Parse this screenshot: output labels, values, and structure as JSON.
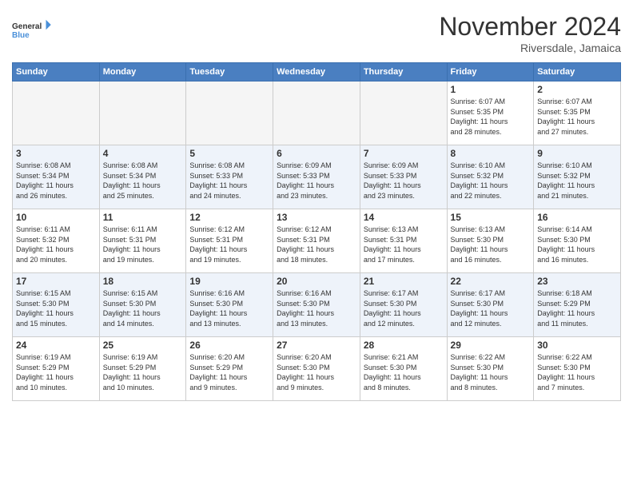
{
  "logo": {
    "line1": "General",
    "line2": "Blue"
  },
  "title": "November 2024",
  "location": "Riversdale, Jamaica",
  "days_of_week": [
    "Sunday",
    "Monday",
    "Tuesday",
    "Wednesday",
    "Thursday",
    "Friday",
    "Saturday"
  ],
  "weeks": [
    [
      {
        "day": "",
        "info": "",
        "empty": true
      },
      {
        "day": "",
        "info": "",
        "empty": true
      },
      {
        "day": "",
        "info": "",
        "empty": true
      },
      {
        "day": "",
        "info": "",
        "empty": true
      },
      {
        "day": "",
        "info": "",
        "empty": true
      },
      {
        "day": "1",
        "info": "Sunrise: 6:07 AM\nSunset: 5:35 PM\nDaylight: 11 hours\nand 28 minutes."
      },
      {
        "day": "2",
        "info": "Sunrise: 6:07 AM\nSunset: 5:35 PM\nDaylight: 11 hours\nand 27 minutes."
      }
    ],
    [
      {
        "day": "3",
        "info": "Sunrise: 6:08 AM\nSunset: 5:34 PM\nDaylight: 11 hours\nand 26 minutes."
      },
      {
        "day": "4",
        "info": "Sunrise: 6:08 AM\nSunset: 5:34 PM\nDaylight: 11 hours\nand 25 minutes."
      },
      {
        "day": "5",
        "info": "Sunrise: 6:08 AM\nSunset: 5:33 PM\nDaylight: 11 hours\nand 24 minutes."
      },
      {
        "day": "6",
        "info": "Sunrise: 6:09 AM\nSunset: 5:33 PM\nDaylight: 11 hours\nand 23 minutes."
      },
      {
        "day": "7",
        "info": "Sunrise: 6:09 AM\nSunset: 5:33 PM\nDaylight: 11 hours\nand 23 minutes."
      },
      {
        "day": "8",
        "info": "Sunrise: 6:10 AM\nSunset: 5:32 PM\nDaylight: 11 hours\nand 22 minutes."
      },
      {
        "day": "9",
        "info": "Sunrise: 6:10 AM\nSunset: 5:32 PM\nDaylight: 11 hours\nand 21 minutes."
      }
    ],
    [
      {
        "day": "10",
        "info": "Sunrise: 6:11 AM\nSunset: 5:32 PM\nDaylight: 11 hours\nand 20 minutes."
      },
      {
        "day": "11",
        "info": "Sunrise: 6:11 AM\nSunset: 5:31 PM\nDaylight: 11 hours\nand 19 minutes."
      },
      {
        "day": "12",
        "info": "Sunrise: 6:12 AM\nSunset: 5:31 PM\nDaylight: 11 hours\nand 19 minutes."
      },
      {
        "day": "13",
        "info": "Sunrise: 6:12 AM\nSunset: 5:31 PM\nDaylight: 11 hours\nand 18 minutes."
      },
      {
        "day": "14",
        "info": "Sunrise: 6:13 AM\nSunset: 5:31 PM\nDaylight: 11 hours\nand 17 minutes."
      },
      {
        "day": "15",
        "info": "Sunrise: 6:13 AM\nSunset: 5:30 PM\nDaylight: 11 hours\nand 16 minutes."
      },
      {
        "day": "16",
        "info": "Sunrise: 6:14 AM\nSunset: 5:30 PM\nDaylight: 11 hours\nand 16 minutes."
      }
    ],
    [
      {
        "day": "17",
        "info": "Sunrise: 6:15 AM\nSunset: 5:30 PM\nDaylight: 11 hours\nand 15 minutes."
      },
      {
        "day": "18",
        "info": "Sunrise: 6:15 AM\nSunset: 5:30 PM\nDaylight: 11 hours\nand 14 minutes."
      },
      {
        "day": "19",
        "info": "Sunrise: 6:16 AM\nSunset: 5:30 PM\nDaylight: 11 hours\nand 13 minutes."
      },
      {
        "day": "20",
        "info": "Sunrise: 6:16 AM\nSunset: 5:30 PM\nDaylight: 11 hours\nand 13 minutes."
      },
      {
        "day": "21",
        "info": "Sunrise: 6:17 AM\nSunset: 5:30 PM\nDaylight: 11 hours\nand 12 minutes."
      },
      {
        "day": "22",
        "info": "Sunrise: 6:17 AM\nSunset: 5:30 PM\nDaylight: 11 hours\nand 12 minutes."
      },
      {
        "day": "23",
        "info": "Sunrise: 6:18 AM\nSunset: 5:29 PM\nDaylight: 11 hours\nand 11 minutes."
      }
    ],
    [
      {
        "day": "24",
        "info": "Sunrise: 6:19 AM\nSunset: 5:29 PM\nDaylight: 11 hours\nand 10 minutes."
      },
      {
        "day": "25",
        "info": "Sunrise: 6:19 AM\nSunset: 5:29 PM\nDaylight: 11 hours\nand 10 minutes."
      },
      {
        "day": "26",
        "info": "Sunrise: 6:20 AM\nSunset: 5:29 PM\nDaylight: 11 hours\nand 9 minutes."
      },
      {
        "day": "27",
        "info": "Sunrise: 6:20 AM\nSunset: 5:30 PM\nDaylight: 11 hours\nand 9 minutes."
      },
      {
        "day": "28",
        "info": "Sunrise: 6:21 AM\nSunset: 5:30 PM\nDaylight: 11 hours\nand 8 minutes."
      },
      {
        "day": "29",
        "info": "Sunrise: 6:22 AM\nSunset: 5:30 PM\nDaylight: 11 hours\nand 8 minutes."
      },
      {
        "day": "30",
        "info": "Sunrise: 6:22 AM\nSunset: 5:30 PM\nDaylight: 11 hours\nand 7 minutes."
      }
    ]
  ]
}
